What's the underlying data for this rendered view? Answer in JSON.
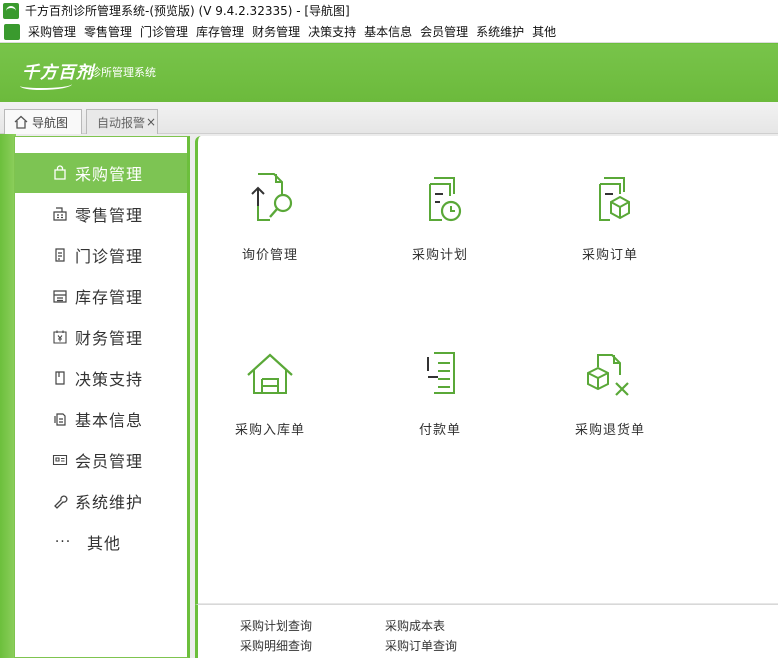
{
  "window": {
    "title": "千方百剂诊所管理系统-(预览版) (V 9.4.2.32335)    - [导航图]"
  },
  "menubar": {
    "items": [
      "采购管理",
      "零售管理",
      "门诊管理",
      "库存管理",
      "财务管理",
      "决策支持",
      "基本信息",
      "会员管理",
      "系统维护",
      "其他"
    ]
  },
  "banner": {
    "logo_text": "千方百剂",
    "subtitle": "诊所管理系统"
  },
  "tabs": {
    "home_label": "导航图",
    "alert_label": "自动报警",
    "close_glyph": "×"
  },
  "sidebar": {
    "items": [
      {
        "label": "采购管理",
        "icon": "bag-icon",
        "active": true
      },
      {
        "label": "零售管理",
        "icon": "cash-register-icon",
        "active": false
      },
      {
        "label": "门诊管理",
        "icon": "clipboard-icon",
        "active": false
      },
      {
        "label": "库存管理",
        "icon": "warehouse-icon",
        "active": false
      },
      {
        "label": "财务管理",
        "icon": "calendar-yen-icon",
        "active": false
      },
      {
        "label": "决策支持",
        "icon": "bookmark-icon",
        "active": false
      },
      {
        "label": "基本信息",
        "icon": "document-icon",
        "active": false
      },
      {
        "label": "会员管理",
        "icon": "id-card-icon",
        "active": false
      },
      {
        "label": "系统维护",
        "icon": "wrench-icon",
        "active": false
      },
      {
        "label": "其他",
        "icon": "more-icon",
        "active": false
      }
    ],
    "more_glyph": "···"
  },
  "tiles": [
    {
      "label": "询价管理",
      "icon": "inquiry-search-icon"
    },
    {
      "label": "采购计划",
      "icon": "plan-clock-icon"
    },
    {
      "label": "采购订单",
      "icon": "order-box-icon"
    },
    {
      "label": "采购入库单",
      "icon": "warehouse-entry-icon"
    },
    {
      "label": "付款单",
      "icon": "payment-list-icon"
    },
    {
      "label": "采购退货单",
      "icon": "return-box-icon"
    }
  ],
  "quick_links": [
    "采购计划查询",
    "采购成本表",
    "采购明细查询",
    "采购订单查询"
  ],
  "colors": {
    "brand_green": "#6cbf3c",
    "active_green": "#7dc453",
    "icon_green": "#5aa838"
  }
}
